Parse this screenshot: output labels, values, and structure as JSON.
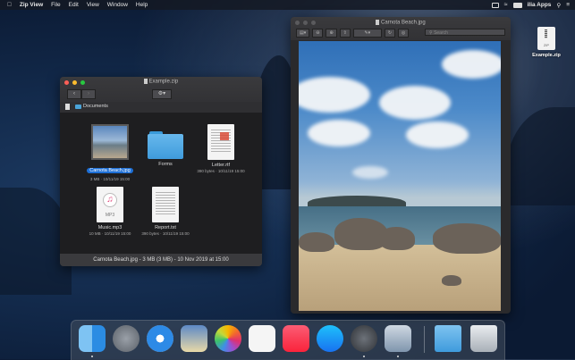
{
  "menubar": {
    "app_name": "Zip View",
    "items": [
      "File",
      "Edit",
      "View",
      "Window",
      "Help"
    ],
    "user": "ilia Apps"
  },
  "desktop": {
    "file_label": "Example.zip",
    "file_ext": "ZIP"
  },
  "zip_window": {
    "title": "Example.zip",
    "path": "Documents",
    "files": [
      {
        "name": "Carnota Beach.jpg",
        "meta": "3 MB · 10/11/19 15:00",
        "kind": "photo",
        "selected": true
      },
      {
        "name": "Forms",
        "meta": "",
        "kind": "folder",
        "selected": false
      },
      {
        "name": "Letter.rtf",
        "meta": "390 bytes · 10/11/19 15:00",
        "kind": "rtf",
        "selected": false
      },
      {
        "name": "Music.mp3",
        "meta": "10 MB · 10/11/19 15:00",
        "kind": "mp3",
        "mp3_label": "MP3",
        "selected": false
      },
      {
        "name": "Report.txt",
        "meta": "390 bytes · 10/11/19 15:00",
        "kind": "txt",
        "selected": false
      }
    ],
    "status": "Carnota Beach.jpg - 3 MB (3 MB) - 10 Nov 2019 at 15:00"
  },
  "preview_window": {
    "title": "Carnota Beach.jpg",
    "search_placeholder": "Search"
  },
  "dock": {
    "apps": [
      "Finder",
      "Launchpad",
      "Safari",
      "Mail",
      "Photos",
      "Reminders",
      "Music",
      "App Store",
      "Zip View",
      "Preview",
      "Downloads",
      "Trash"
    ]
  }
}
